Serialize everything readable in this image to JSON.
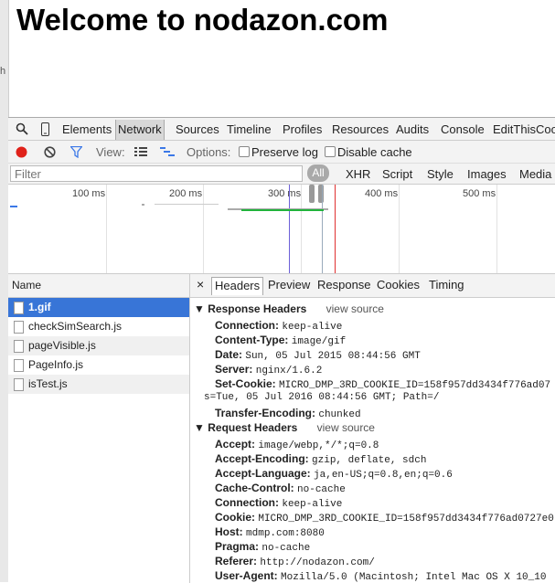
{
  "page": {
    "title": "Welcome to nodazon.com"
  },
  "devtools": {
    "tabs": [
      "Elements",
      "Network",
      "Sources",
      "Timeline",
      "Profiles",
      "Resources",
      "Audits",
      "Console",
      "EditThisCookie"
    ],
    "active_tab": "Network",
    "toolbar": {
      "view_label": "View:",
      "options_label": "Options:",
      "preserve_log": "Preserve log",
      "disable_cache": "Disable cache"
    },
    "filter": {
      "placeholder": "Filter",
      "all": "All",
      "types": [
        "XHR",
        "Script",
        "Style",
        "Images",
        "Media"
      ]
    },
    "timeline": {
      "ticks": [
        "100 ms",
        "200 ms",
        "300 ms",
        "400 ms",
        "500 ms"
      ]
    },
    "requests": {
      "header": "Name",
      "items": [
        "1.gif",
        "checkSimSearch.js",
        "pageVisible.js",
        "PageInfo.js",
        "isTest.js"
      ],
      "selected": "1.gif"
    },
    "detail": {
      "close": "×",
      "tabs": [
        "Headers",
        "Preview",
        "Response",
        "Cookies",
        "Timing"
      ],
      "active_tab": "Headers",
      "response_title": "Response Headers",
      "request_title": "Request Headers",
      "view_source": "view source",
      "response_headers": [
        {
          "k": "Connection:",
          "v": "keep-alive"
        },
        {
          "k": "Content-Type:",
          "v": "image/gif"
        },
        {
          "k": "Date:",
          "v": "Sun, 05 Jul 2015 08:44:56 GMT"
        },
        {
          "k": "Server:",
          "v": "nginx/1.6.2"
        },
        {
          "k": "Set-Cookie:",
          "v": "MICRO_DMP_3RD_COOKIE_ID=158f957dd3434f776ad07"
        },
        {
          "k": "Transfer-Encoding:",
          "v": "chunked"
        }
      ],
      "set_cookie_wrap": "s=Tue, 05 Jul 2016 08:44:56 GMT; Path=/",
      "request_headers": [
        {
          "k": "Accept:",
          "v": "image/webp,*/*;q=0.8"
        },
        {
          "k": "Accept-Encoding:",
          "v": "gzip, deflate, sdch"
        },
        {
          "k": "Accept-Language:",
          "v": "ja,en-US;q=0.8,en;q=0.6"
        },
        {
          "k": "Cache-Control:",
          "v": "no-cache"
        },
        {
          "k": "Connection:",
          "v": "keep-alive"
        },
        {
          "k": "Cookie:",
          "v": "MICRO_DMP_3RD_COOKIE_ID=158f957dd3434f776ad0727e0"
        },
        {
          "k": "Host:",
          "v": "mdmp.com:8080"
        },
        {
          "k": "Pragma:",
          "v": "no-cache"
        },
        {
          "k": "Referer:",
          "v": "http://nodazon.com/"
        },
        {
          "k": "User-Agent:",
          "v": "Mozilla/5.0 (Macintosh; Intel Mac OS X 10_10"
        }
      ]
    }
  }
}
